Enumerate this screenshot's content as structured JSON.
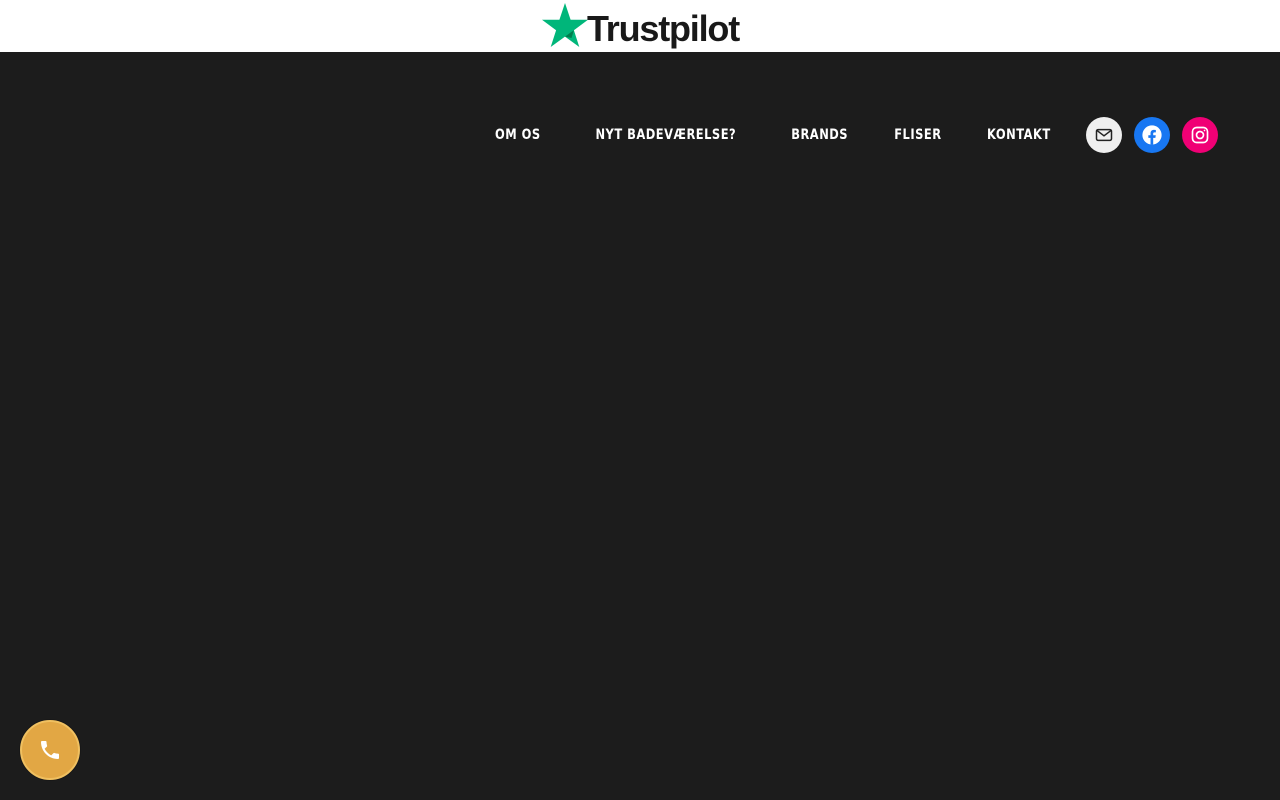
{
  "topbar": {
    "logo_text": "Trustpilot",
    "logo_star_color": "#00b67a"
  },
  "nav": {
    "items": [
      {
        "label": "OM OS"
      },
      {
        "label": "NYT BADEVÆRELSE?"
      },
      {
        "label": "BRANDS"
      },
      {
        "label": "FLISER"
      },
      {
        "label": "KONTAKT"
      }
    ]
  },
  "socials": [
    {
      "icon": "mail-icon",
      "color": "#efefef"
    },
    {
      "icon": "facebook-icon",
      "color": "#1877f2"
    },
    {
      "icon": "instagram-icon",
      "color": "#f00075"
    }
  ],
  "call_button": {
    "icon": "phone-icon",
    "color": "#e2a744"
  },
  "colors": {
    "background": "#1c1c1c",
    "topbar": "#ffffff",
    "nav_text": "#ffffff"
  }
}
